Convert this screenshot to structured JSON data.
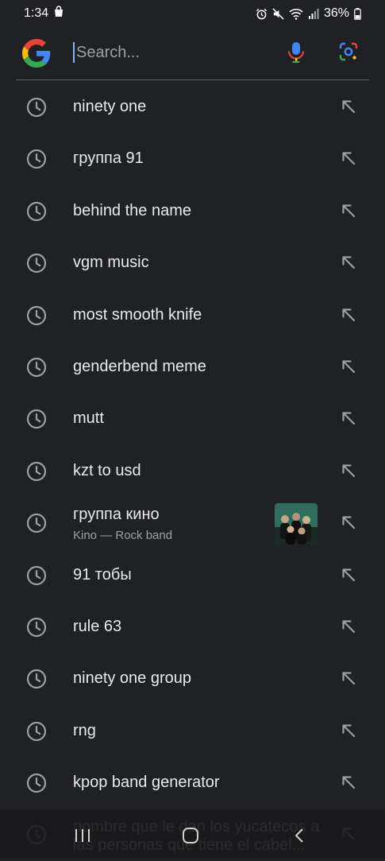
{
  "status_bar": {
    "time": "1:34",
    "battery": "36%",
    "icons": [
      "shopping-bag-icon",
      "alarm-icon",
      "mute-icon",
      "wifi-icon",
      "signal-icon",
      "battery-icon"
    ]
  },
  "search": {
    "placeholder": "Search...",
    "value": ""
  },
  "suggestions": [
    {
      "text": "ninety one",
      "icon": "history-icon",
      "action": "fill-arrow-icon"
    },
    {
      "text": "группа 91",
      "icon": "history-icon",
      "action": "fill-arrow-icon"
    },
    {
      "text": "behind the name",
      "icon": "history-icon",
      "action": "fill-arrow-icon"
    },
    {
      "text": "vgm music",
      "icon": "history-icon",
      "action": "fill-arrow-icon"
    },
    {
      "text": "most smooth knife",
      "icon": "history-icon",
      "action": "fill-arrow-icon"
    },
    {
      "text": "genderbend meme",
      "icon": "history-icon",
      "action": "fill-arrow-icon"
    },
    {
      "text": "mutt",
      "icon": "history-icon",
      "action": "fill-arrow-icon"
    },
    {
      "text": "kzt to usd",
      "icon": "history-icon",
      "action": "fill-arrow-icon"
    },
    {
      "text": "группа кино",
      "subtitle": "Kino — Rock band",
      "icon": "history-icon",
      "action": "fill-arrow-icon",
      "thumbnail": "band-photo"
    },
    {
      "text": "91 тобы",
      "icon": "history-icon",
      "action": "fill-arrow-icon"
    },
    {
      "text": "rule 63",
      "icon": "history-icon",
      "action": "fill-arrow-icon"
    },
    {
      "text": "ninety one group",
      "icon": "history-icon",
      "action": "fill-arrow-icon"
    },
    {
      "text": "rng",
      "icon": "history-icon",
      "action": "fill-arrow-icon"
    },
    {
      "text": "kpop band generator",
      "icon": "history-icon",
      "action": "fill-arrow-icon"
    },
    {
      "text": "nombre que le dan los yucatecos a las personas que tiene el cabel...",
      "icon": "history-icon",
      "action": "fill-arrow-icon"
    }
  ],
  "nav_bar": {
    "icons": [
      "recents-icon",
      "home-icon",
      "back-icon"
    ]
  },
  "colors": {
    "background": "#202124",
    "text": "#e8eaed",
    "subtext": "#9aa0a6",
    "accent": "#8ab4f8"
  }
}
